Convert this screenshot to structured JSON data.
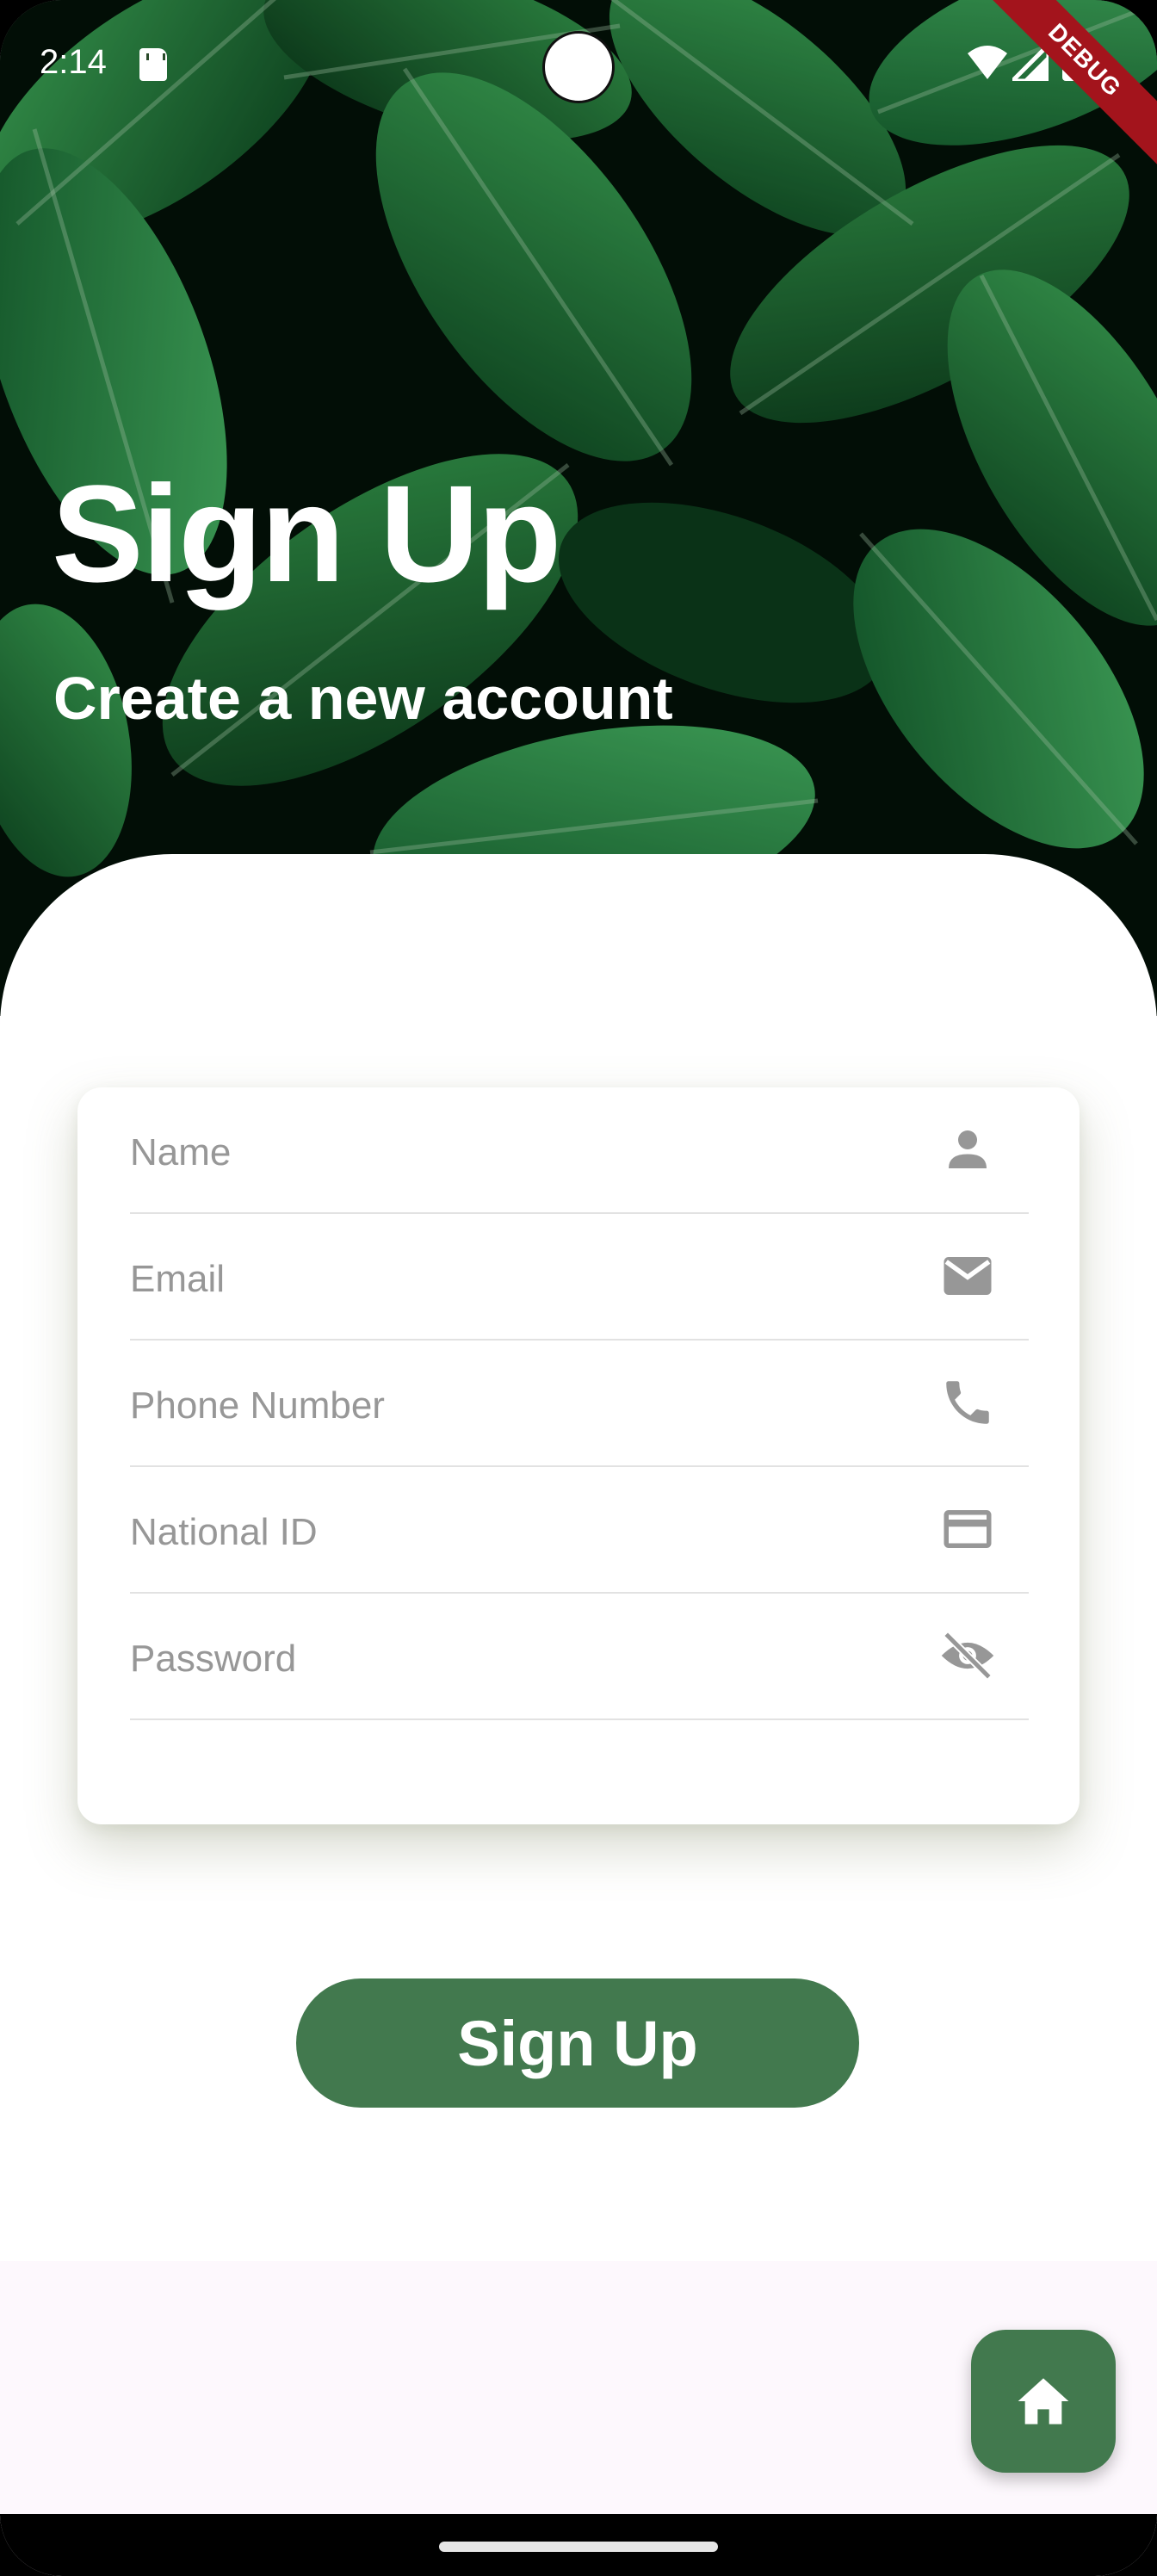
{
  "status_bar": {
    "time": "2:14",
    "debug_banner": "DEBUG",
    "icons": [
      "sd-card-icon",
      "wifi-icon",
      "signal-icon",
      "battery-icon"
    ]
  },
  "header": {
    "title": "Sign Up",
    "subtitle": "Create a new account"
  },
  "form": {
    "fields": [
      {
        "label": "Name",
        "icon": "person-icon"
      },
      {
        "label": "Email",
        "icon": "mail-icon"
      },
      {
        "label": "Phone Number",
        "icon": "phone-icon"
      },
      {
        "label": "National ID",
        "icon": "credit-card-icon"
      },
      {
        "label": "Password",
        "icon": "visibility-off-icon"
      }
    ]
  },
  "actions": {
    "signup_label": "Sign Up",
    "home_icon": "home-icon"
  },
  "colors": {
    "primary": "#42794e",
    "hint_text": "#979797",
    "divider": "#e2e2e2",
    "debug_ribbon": "#a3141c",
    "page_background": "#fdf8fd"
  }
}
